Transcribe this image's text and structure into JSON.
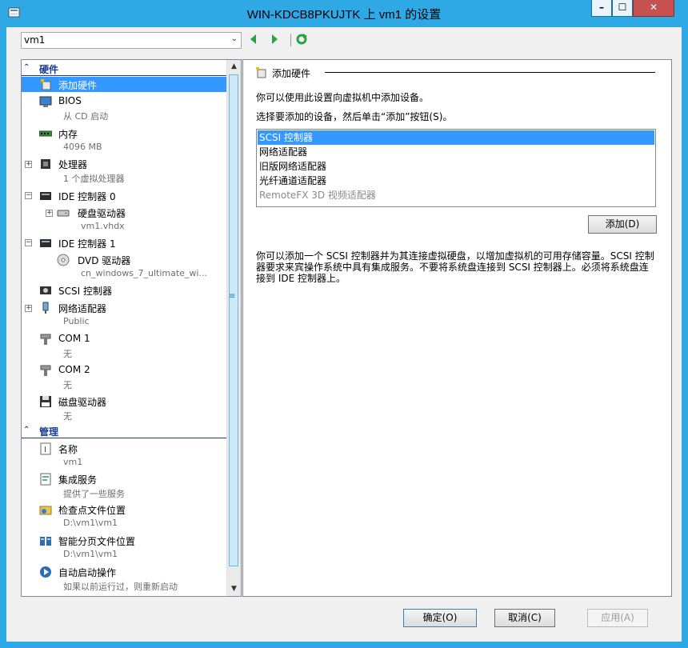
{
  "window": {
    "title": "WIN-KDCB8PKUJTK 上 vm1 的设置",
    "minimize": "–",
    "maximize": "☐",
    "close": "✕",
    "accent": "#2fa9e6"
  },
  "vm_selector": {
    "value": "vm1"
  },
  "tree": {
    "hardware_section": "硬件",
    "management_section": "管理",
    "items": [
      {
        "label": "添加硬件",
        "sub": "",
        "icon": "add-hardware-icon"
      },
      {
        "label": "BIOS",
        "sub": "从 CD 启动",
        "icon": "bios-icon"
      },
      {
        "label": "内存",
        "sub": "4096 MB",
        "icon": "memory-icon"
      },
      {
        "label": "处理器",
        "sub": "1 个虚拟处理器",
        "icon": "processor-icon"
      },
      {
        "label": "IDE 控制器 0",
        "sub": "",
        "icon": "ide-controller-icon"
      },
      {
        "label": "硬盘驱动器",
        "sub": "vm1.vhdx",
        "icon": "hard-drive-icon"
      },
      {
        "label": "IDE 控制器 1",
        "sub": "",
        "icon": "ide-controller-icon"
      },
      {
        "label": "DVD 驱动器",
        "sub": "cn_windows_7_ultimate_wi...",
        "icon": "dvd-drive-icon"
      },
      {
        "label": "SCSI 控制器",
        "sub": "",
        "icon": "scsi-controller-icon"
      },
      {
        "label": "网络适配器",
        "sub": "Public",
        "icon": "network-adapter-icon"
      },
      {
        "label": "COM 1",
        "sub": "无",
        "icon": "com-port-icon"
      },
      {
        "label": "COM 2",
        "sub": "无",
        "icon": "com-port-icon"
      },
      {
        "label": "磁盘驱动器",
        "sub": "无",
        "icon": "floppy-drive-icon"
      }
    ],
    "management_items": [
      {
        "label": "名称",
        "sub": "vm1",
        "icon": "name-icon"
      },
      {
        "label": "集成服务",
        "sub": "提供了一些服务",
        "icon": "integration-services-icon"
      },
      {
        "label": "检查点文件位置",
        "sub": "D:\\vm1\\vm1",
        "icon": "checkpoint-folder-icon"
      },
      {
        "label": "智能分页文件位置",
        "sub": "D:\\vm1\\vm1",
        "icon": "paging-folder-icon"
      },
      {
        "label": "自动启动操作",
        "sub": "如果以前运行过，则重新启动",
        "icon": "auto-start-icon"
      }
    ]
  },
  "panel": {
    "heading": "添加硬件",
    "intro": "你可以使用此设置向虚拟机中添加设备。",
    "instruction": "选择要添加的设备，然后单击“添加”按钮(S)。",
    "devices": [
      "SCSI 控制器",
      "网络适配器",
      "旧版网络适配器",
      "光纤通道适配器",
      "RemoteFX 3D 视频适配器"
    ],
    "selected_device": "SCSI 控制器",
    "add_button": "添加(D)",
    "description": "你可以添加一个 SCSI 控制器并为其连接虚拟硬盘，以增加虚拟机的可用存储容量。SCSI 控制器要求来宾操作系统中具有集成服务。不要将系统盘连接到 SCSI 控制器上。必须将系统盘连接到 IDE 控制器上。"
  },
  "footer": {
    "ok": "确定(O)",
    "cancel": "取消(C)",
    "apply": "应用(A)"
  }
}
